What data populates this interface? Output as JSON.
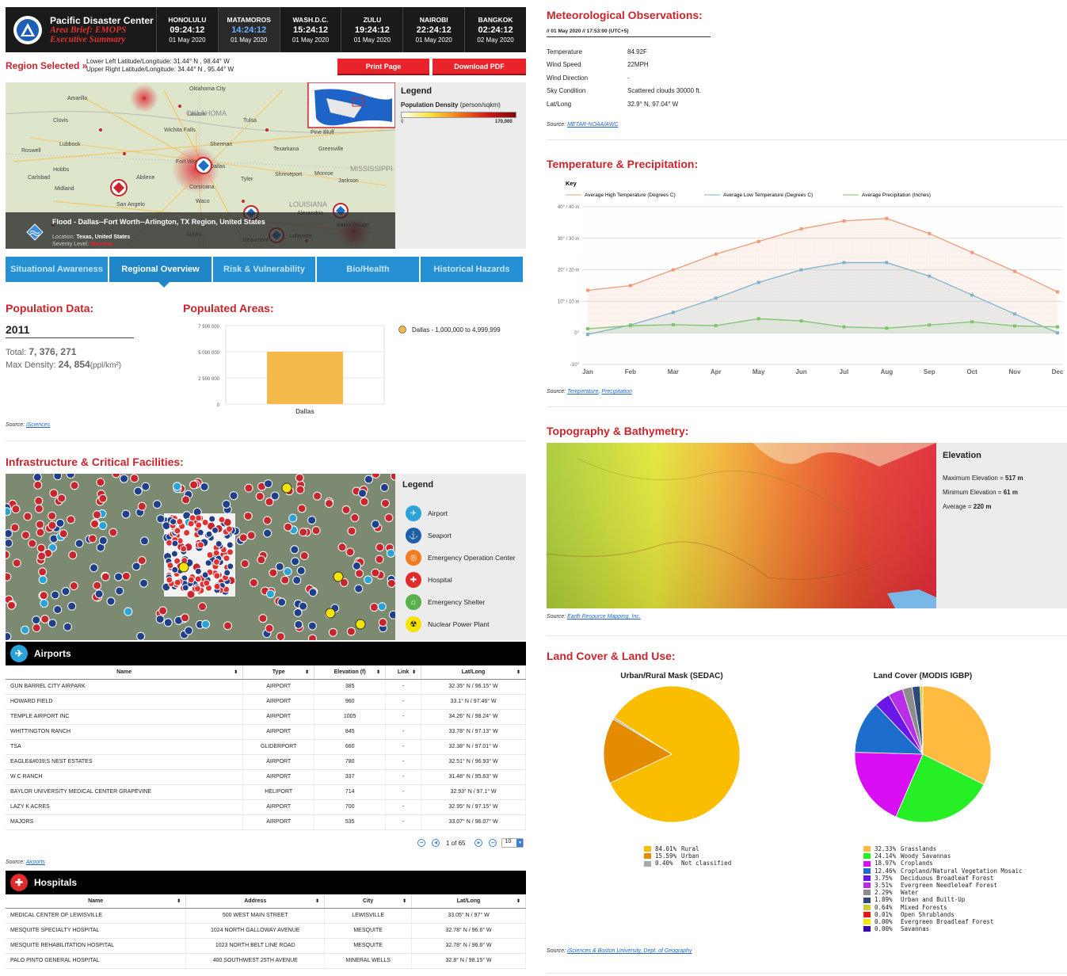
{
  "header": {
    "org": "Pacific Disaster Center",
    "brief1": "Area Brief: EMOPS",
    "brief2": "Executive Summary",
    "clocks": [
      {
        "city": "HONOLULU",
        "time": "09:24:12",
        "date": "01 May 2020"
      },
      {
        "city": "MATAMOROS",
        "time": "14:24:12",
        "date": "01 May 2020"
      },
      {
        "city": "WASH.D.C.",
        "time": "15:24:12",
        "date": "01 May 2020"
      },
      {
        "city": "ZULU",
        "time": "19:24:12",
        "date": "01 May 2020"
      },
      {
        "city": "NAIROBI",
        "time": "22:24:12",
        "date": "01 May 2020"
      },
      {
        "city": "BANGKOK",
        "time": "02:24:12",
        "date": "02 May 2020"
      }
    ]
  },
  "region": {
    "label": "Region Selected »",
    "ll": "Lower Left Latitude/Longitude: 31.44° N , 98.44° W",
    "ur": "Upper Right Latitude/Longitude: 34.44° N , 95.44° W",
    "print": "Print Page",
    "pdf": "Download PDF"
  },
  "map": {
    "places": [
      "Amarillo",
      "Clovis",
      "Lubbock",
      "Roswell",
      "Hobbs",
      "Carlsbad",
      "Midland",
      "San Angelo",
      "Abilene",
      "Wichita Falls",
      "Lawton",
      "OKLAHOMA",
      "Oklahoma City",
      "Tulsa",
      "Fort Worth",
      "Dallas",
      "Sherman",
      "Texarkana",
      "Shreveport",
      "Monroe",
      "Jackson",
      "MISSISSIPPI",
      "Tyler",
      "Waco",
      "Austin",
      "LOUISIANA",
      "Lafayette",
      "Baton Rouge",
      "Greenville",
      "Corsicana",
      "Alexandria",
      "Beaumont",
      "Pine Bluff"
    ],
    "event_title": "Flood - Dallas--Fort Worth--Arlington, TX Region, United States",
    "location_label": "Location:",
    "location": "Texas, United States",
    "severity_label": "Severity Level:",
    "severity": "Warning"
  },
  "legend": {
    "title": "Legend",
    "pd_label": "Population Density",
    "pd_unit": "(person/sqkm)",
    "min": "0",
    "max": "170,000"
  },
  "tabs": [
    "Situational Awareness",
    "Regional Overview",
    "Risk & Vulnerability",
    "Bio/Health",
    "Historical Hazards"
  ],
  "population": {
    "title": "Population Data:",
    "year": "2011",
    "total_label": "Total:",
    "total": "7, 376, 271",
    "maxd_label": "Max Density:",
    "maxd": "24, 854",
    "maxd_unit": "(ppl/km²)",
    "source_label": "Source:",
    "source": "iSciences"
  },
  "populated": {
    "title": "Populated Areas:",
    "legend": "Dallas - 1,000,000 to 4,999,999"
  },
  "chart_data": [
    {
      "type": "bar",
      "categories": [
        "Dallas"
      ],
      "values": [
        5000000
      ],
      "ylim": [
        0,
        7500000
      ],
      "yticks": [
        "7 500 000",
        "5 000 000",
        "2 500 000",
        "0"
      ],
      "colors": {
        "bar": "#f5b94a"
      }
    },
    {
      "type": "line",
      "title": "Key",
      "categories": [
        "Jan",
        "Feb",
        "Mar",
        "Apr",
        "May",
        "Jun",
        "Jul",
        "Aug",
        "Sep",
        "Oct",
        "Nov",
        "Dec"
      ],
      "ylim": [
        -10,
        40
      ],
      "yticks": [
        "40° / 40 in",
        "30° / 30 in",
        "20° / 20 in",
        "10° / 10 in",
        "0°",
        "-10°"
      ],
      "series": [
        {
          "name": "Average High Temperature (Degrees C)",
          "color": "#f09a74",
          "values": [
            13.5,
            15,
            20,
            25,
            29,
            33,
            35.5,
            36.3,
            31.5,
            25.5,
            19.5,
            13
          ]
        },
        {
          "name": "Average Low Temperature (Degrees C)",
          "color": "#7fb3cc",
          "values": [
            -0.5,
            2.5,
            6.5,
            11,
            16,
            20,
            22.3,
            22.3,
            18,
            12,
            6,
            0
          ]
        },
        {
          "name": "Average Precipitation (Inches)",
          "color": "#7cc66a",
          "values": [
            1.3,
            2.3,
            2.6,
            2.3,
            4.5,
            3.8,
            1.9,
            1.5,
            2.5,
            3.5,
            2.2,
            1.9
          ]
        }
      ]
    },
    {
      "type": "pie",
      "title": "Urban/Rural Mask (SEDAC)",
      "slices": [
        {
          "label": "Rural",
          "pct": "84.01%",
          "value": 84.01,
          "color": "#fbbd00"
        },
        {
          "label": "Urban",
          "pct": "15.59%",
          "value": 15.59,
          "color": "#e58b00"
        },
        {
          "label": "Not classified",
          "pct": "0.40%",
          "value": 0.4,
          "color": "#a9a9a9"
        }
      ]
    },
    {
      "type": "pie",
      "title": "Land Cover (MODIS IGBP)",
      "slices": [
        {
          "label": "Grasslands",
          "pct": "32.33%",
          "value": 32.33,
          "color": "#ffba3f"
        },
        {
          "label": "Woody Savannas",
          "pct": "24.14%",
          "value": 24.14,
          "color": "#26ef26"
        },
        {
          "label": "Croplands",
          "pct": "18.97%",
          "value": 18.97,
          "color": "#da0ef5"
        },
        {
          "label": "Cropland/Natural Vegetation Mosaic",
          "pct": "12.46%",
          "value": 12.46,
          "color": "#1d6dcc"
        },
        {
          "label": "Deciduous Broadleaf Forest",
          "pct": "3.75%",
          "value": 3.75,
          "color": "#6a16e6"
        },
        {
          "label": "Evergreen Needleleaf Forest",
          "pct": "3.51%",
          "value": 3.51,
          "color": "#b82ee6"
        },
        {
          "label": "Water",
          "pct": "2.29%",
          "value": 2.29,
          "color": "#8c8c8c"
        },
        {
          "label": "Urban and Built-Up",
          "pct": "1.89%",
          "value": 1.89,
          "color": "#2c4a75"
        },
        {
          "label": "Mixed Forests",
          "pct": "0.64%",
          "value": 0.64,
          "color": "#cfcf34"
        },
        {
          "label": "Open Shrublands",
          "pct": "0.01%",
          "value": 0.01,
          "color": "#f01515"
        },
        {
          "label": "Evergreen Broadleaf Forest",
          "pct": "0.00%",
          "value": 0.0,
          "color": "#f5e600"
        },
        {
          "label": "Savannas",
          "pct": "0.00%",
          "value": 0.0,
          "color": "#3b00b3"
        }
      ]
    }
  ],
  "infra": {
    "title": "Infrastructure & Critical Facilities:",
    "legend_title": "Legend",
    "legend": [
      {
        "label": "Airport",
        "icon": "airplane-icon",
        "color": "#2aa3d8"
      },
      {
        "label": "Seaport",
        "icon": "anchor-icon",
        "color": "#1f5ea8"
      },
      {
        "label": "Emergency Operation Center",
        "icon": "eoc-icon",
        "color": "#f37b1d"
      },
      {
        "label": "Hospital",
        "icon": "hospital-icon",
        "color": "#e02b2b"
      },
      {
        "label": "Emergency Shelter",
        "icon": "shelter-icon",
        "color": "#5ab04c"
      },
      {
        "label": "Nuclear Power Plant",
        "icon": "nuclear-icon",
        "color": "#f5e400"
      }
    ]
  },
  "airports": {
    "title": "Airports",
    "cols": [
      "Name",
      "Type",
      "Elevation (f)",
      "Link",
      "Lat/Long"
    ],
    "rows": [
      [
        "GUN BARREL CITY AIRPARK",
        "AIRPORT",
        "385",
        "-",
        "32.35° N / 96.15° W"
      ],
      [
        "HOWARD FIELD",
        "AIRPORT",
        "960",
        "-",
        "33.1° N / 97.46° W"
      ],
      [
        "TEMPLE AIRPORT INC",
        "AIRPORT",
        "1005",
        "-",
        "34.26° N / 98.24° W"
      ],
      [
        "WHITTINGTON RANCH",
        "AIRPORT",
        "845",
        "-",
        "33.78° N / 97.13° W"
      ],
      [
        "TSA",
        "GLIDERPORT",
        "660",
        "-",
        "32.38° N / 97.01° W"
      ],
      [
        "EAGLE&#039;S NEST ESTATES",
        "AIRPORT",
        "780",
        "-",
        "32.51° N / 96.93° W"
      ],
      [
        "W C RANCH",
        "AIRPORT",
        "337",
        "-",
        "31.48° N / 95.63° W"
      ],
      [
        "BAYLOR UNIVERSITY MEDICAL CENTER GRAPEVINE",
        "HELIPORT",
        "714",
        "-",
        "32.93° N / 97.1° W"
      ],
      [
        "LAZY K ACRES",
        "AIRPORT",
        "700",
        "-",
        "32.95° N / 97.15° W"
      ],
      [
        "MAJORS",
        "AIRPORT",
        "535",
        "-",
        "33.07° N / 96.07° W"
      ]
    ],
    "page": "1 of 65",
    "per_page": "10",
    "source_label": "Source:",
    "source": "Airports"
  },
  "hospitals": {
    "title": "Hospitals",
    "cols": [
      "Name",
      "Address",
      "City",
      "Lat/Long"
    ],
    "rows": [
      [
        "MEDICAL CENTER OF LEWISVILLE",
        "500 WEST MAIN STREET",
        "LEWISVILLE",
        "33.05° N / 97° W"
      ],
      [
        "MESQUITE SPECIALTY HOSPITAL",
        "1024 NORTH GALLOWAY AVENUE",
        "MESQUITE",
        "32.78° N / 96.6° W"
      ],
      [
        "MESQUITE REHABILITATION HOSPITAL",
        "1023 NORTH BELT LINE ROAD",
        "MESQUITE",
        "32.78° N / 96.6° W"
      ],
      [
        "PALO PINTO GENERAL HOSPITAL",
        "400 SOUTHWEST 25TH AVENUE",
        "MINERAL WELLS",
        "32.8° N / 98.15° W"
      ]
    ]
  },
  "met": {
    "title": "Meteorological Observations:",
    "stamp": "// 01 May 2020 // 17:53:00 (UTC+5)",
    "rows": [
      [
        "Temperature",
        "84.92F"
      ],
      [
        "Wind Speed",
        "22MPH"
      ],
      [
        "Wind Direction",
        "-"
      ],
      [
        "Sky Condition",
        "Scattered clouds 30000 ft."
      ],
      [
        "Lat/Long",
        "32.9° N, 97.04° W"
      ]
    ],
    "source_label": "Source:",
    "source": "METAR-NOAA/AWC"
  },
  "temp": {
    "title": "Temperature & Precipitation:",
    "source_label": "Source:",
    "src1": "Temperature",
    "src2": "Precipitation"
  },
  "topo": {
    "title": "Topography & Bathymetry:",
    "elev_title": "Elevation",
    "max_label": "Maximum Elevation =",
    "max": "517 m",
    "min_label": "Minimum Elevation =",
    "min": "61 m",
    "avg_label": "Average =",
    "avg": "220 m",
    "source_label": "Source:",
    "source": "Earth Resource Mapping, Inc."
  },
  "land": {
    "title": "Land Cover & Land Use:",
    "source_label": "Source:",
    "source": "iSciences & Boston University, Dept. of Geography"
  },
  "colors": {
    "accent": "#c8252c",
    "tab": "#2590d3"
  }
}
